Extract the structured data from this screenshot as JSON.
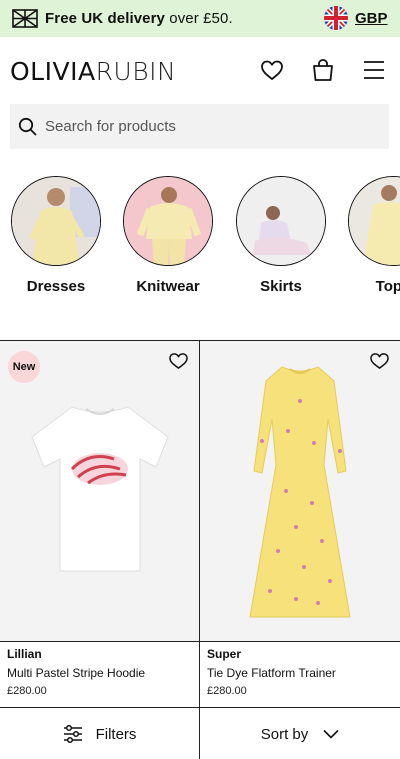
{
  "promo": {
    "text_bold": "Free UK delivery",
    "text_rest": " over £50.",
    "currency": "GBP"
  },
  "header": {
    "logo_left": "OLIVIA",
    "logo_right": "RUBIN"
  },
  "search": {
    "placeholder": "Search for products"
  },
  "categories": [
    {
      "label": "Dresses",
      "colors": [
        "#f3e8b0",
        "#d9d4ea",
        "#f6f0d9"
      ]
    },
    {
      "label": "Knitwear",
      "colors": [
        "#f6c8ce",
        "#f6ecb2",
        "#f3e4a6"
      ]
    },
    {
      "label": "Skirts",
      "colors": [
        "#ececec",
        "#e8d8ee",
        "#f1dde2"
      ]
    },
    {
      "label": "Tops",
      "colors": [
        "#f7edba",
        "#f2e6a2",
        "#e9e7e2"
      ]
    }
  ],
  "products": [
    {
      "brand": "Lillian",
      "name": "Multi Pastel Stripe Hoodie",
      "price": "£280.00",
      "badge": "New"
    },
    {
      "brand": "Super",
      "name": "Tie Dye Flatform Trainer",
      "price": "£280.00",
      "badge": ""
    }
  ],
  "bottom_bar": {
    "filters_label": "Filters",
    "sort_label": "Sort by"
  },
  "colors": {
    "promo_bg": "#dff3d6",
    "badge_bg": "#f9d6d8",
    "text": "#111111"
  },
  "icons": {
    "delivery": "ship-flag-icon",
    "flag": "uk-flag-icon",
    "wishlist": "heart-icon",
    "bag": "bag-icon",
    "menu": "hamburger-icon",
    "search": "search-icon",
    "filters": "sliders-icon",
    "sort": "chevron-down-icon"
  }
}
